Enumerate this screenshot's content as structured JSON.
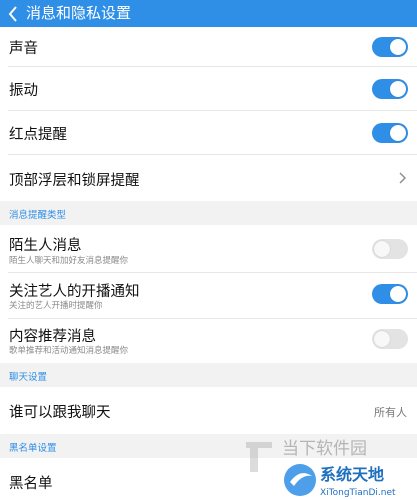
{
  "header": {
    "back_icon": "chevron-left-icon",
    "title": "消息和隐私设置",
    "color": "#2f8ee6"
  },
  "toggles_top": [
    {
      "label": "声音",
      "state": "on"
    },
    {
      "label": "振动",
      "state": "on"
    },
    {
      "label": "红点提醒",
      "state": "on"
    }
  ],
  "float_lock": {
    "label": "顶部浮层和锁屏提醒",
    "icon": "chevron-right-icon"
  },
  "sections": {
    "notice_types": "消息提醒类型",
    "chat": "聊天设置",
    "blacklist": "黑名单设置"
  },
  "notice_items": [
    {
      "label": "陌生人消息",
      "sub": "陌生人聊天和加好友消息提醒你",
      "state": "off"
    },
    {
      "label": "关注艺人的开播通知",
      "sub": "关注的艺人开播时提醒你",
      "state": "on"
    },
    {
      "label": "内容推荐消息",
      "sub": "歌单推荐和活动通知消息提醒你",
      "state": "off"
    }
  ],
  "chat": {
    "label": "谁可以跟我聊天",
    "value": "所有人"
  },
  "blacklist": {
    "label": "黑名单"
  },
  "watermark": {
    "line1": "当下软件园",
    "line2": "系统天地",
    "url": "XiTongTianDi.net"
  }
}
